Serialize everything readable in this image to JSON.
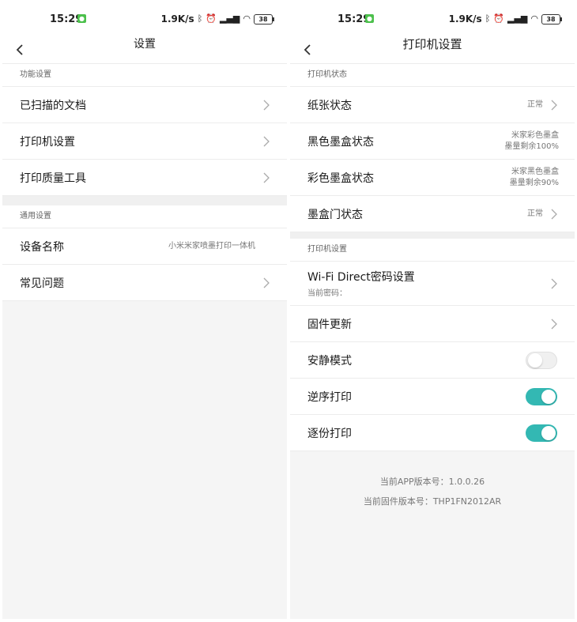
{
  "status_bar": {
    "time": "15:29",
    "notification_icon": "message-icon",
    "speed": "1.9K/s",
    "bluetooth_icon": "bluetooth-icon",
    "alarm_icon": "alarm-icon",
    "signal_icon": "signal-icon",
    "wifi_icon": "wifi-icon",
    "battery": "38"
  },
  "left": {
    "title": "设置",
    "sections": [
      {
        "header": "功能设置",
        "rows": [
          {
            "label": "已扫描的文档"
          },
          {
            "label": "打印机设置"
          },
          {
            "label": "打印质量工具"
          }
        ]
      },
      {
        "header": "通用设置",
        "rows": [
          {
            "label": "设备名称",
            "value": "小米米家喷墨打印一体机"
          },
          {
            "label": "常见问题"
          }
        ]
      }
    ]
  },
  "right": {
    "title": "打印机设置",
    "status_section": {
      "header": "打印机状态",
      "rows": [
        {
          "label": "纸张状态",
          "value": "正常"
        },
        {
          "label": "黑色墨盒状态",
          "value_line1": "米家彩色墨盒",
          "value_line2": "墨量剩余100%"
        },
        {
          "label": "彩色墨盒状态",
          "value_line1": "米家黑色墨盒",
          "value_line2": "墨量剩余90%"
        },
        {
          "label": "墨盒门状态",
          "value": "正常"
        }
      ]
    },
    "settings_section": {
      "header": "打印机设置",
      "wifi_direct": {
        "label": "Wi-Fi Direct密码设置",
        "sub": "当前密码："
      },
      "firmware": {
        "label": "固件更新"
      },
      "quiet_mode": {
        "label": "安静模式",
        "on": false
      },
      "reverse_print": {
        "label": "逆序打印",
        "on": true
      },
      "collate_print": {
        "label": "逐份打印",
        "on": true
      }
    },
    "footer": {
      "app_version": "当前APP版本号：1.0.0.26",
      "firmware_version": "当前固件版本号：THP1FN2012AR"
    }
  },
  "colors": {
    "accent": "#33b8b3",
    "background": "#f5f5f5"
  }
}
